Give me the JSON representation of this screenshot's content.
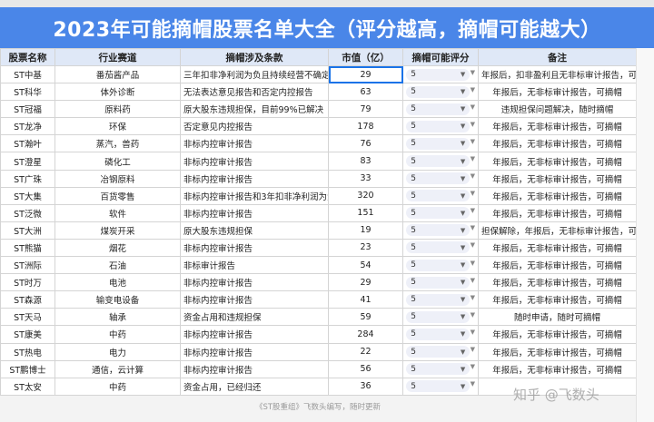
{
  "title": "2023年可能摘帽股票名单大全（评分越高，摘帽可能越大）",
  "headers": [
    "股票名称",
    "行业赛道",
    "摘帽涉及条款",
    "市值（亿）",
    "摘帽可能评分",
    "备注"
  ],
  "rows": [
    {
      "name": "ST中基",
      "industry": "番茄酱产品",
      "clause": "三年扣非净利润为负且持续经营不确定",
      "mcap": "29",
      "score": "5",
      "note": "年报后，扣非盈利且无非标审计报告，可摘帽"
    },
    {
      "name": "ST科华",
      "industry": "体外诊断",
      "clause": "无法表达意见报告和否定内控报告",
      "mcap": "63",
      "score": "5",
      "note": "年报后，无非标审计报告，可摘帽"
    },
    {
      "name": "ST冠福",
      "industry": "原料药",
      "clause": "原大股东违规担保，目前99%已解决",
      "mcap": "79",
      "score": "5",
      "note": "违规担保问题解决，随时摘帽"
    },
    {
      "name": "ST龙净",
      "industry": "环保",
      "clause": "否定意见内控报告",
      "mcap": "178",
      "score": "5",
      "note": "年报后，无非标审计报告，可摘帽"
    },
    {
      "name": "ST瀚叶",
      "industry": "蒸汽，兽药",
      "clause": "非标内控审计报告",
      "mcap": "76",
      "score": "5",
      "note": "年报后，无非标审计报告，可摘帽"
    },
    {
      "name": "ST澄星",
      "industry": "磷化工",
      "clause": "非标内控审计报告",
      "mcap": "83",
      "score": "5",
      "note": "年报后，无非标审计报告，可摘帽"
    },
    {
      "name": "ST广珠",
      "industry": "冶钢原料",
      "clause": "非标内控审计报告",
      "mcap": "33",
      "score": "5",
      "note": "年报后，无非标审计报告，可摘帽"
    },
    {
      "name": "ST大集",
      "industry": "百货零售",
      "clause": "非标内控审计报告和3年扣非净利润为负",
      "mcap": "320",
      "score": "5",
      "note": "年报后，无非标审计报告，可摘帽"
    },
    {
      "name": "ST泛微",
      "industry": "软件",
      "clause": "非标内控审计报告",
      "mcap": "151",
      "score": "5",
      "note": "年报后，无非标审计报告，可摘帽"
    },
    {
      "name": "ST大洲",
      "industry": "煤炭开采",
      "clause": "原大股东违规担保",
      "mcap": "19",
      "score": "5",
      "note": "担保解除，年报后，无非标审计报告，可摘帽"
    },
    {
      "name": "ST熊猫",
      "industry": "烟花",
      "clause": "非标内控审计报告",
      "mcap": "23",
      "score": "5",
      "note": "年报后，无非标审计报告，可摘帽"
    },
    {
      "name": "ST洲际",
      "industry": "石油",
      "clause": "非标审计报告",
      "mcap": "54",
      "score": "5",
      "note": "年报后，无非标审计报告，可摘帽"
    },
    {
      "name": "ST时万",
      "industry": "电池",
      "clause": "非标内控审计报告",
      "mcap": "29",
      "score": "5",
      "note": "年报后，无非标审计报告，可摘帽"
    },
    {
      "name": "ST森源",
      "industry": "输变电设备",
      "clause": "非标内控审计报告",
      "mcap": "41",
      "score": "5",
      "note": "年报后，无非标审计报告，可摘帽"
    },
    {
      "name": "ST天马",
      "industry": "轴承",
      "clause": "资金占用和违规担保",
      "mcap": "59",
      "score": "5",
      "note": "随时申请，随时可摘帽"
    },
    {
      "name": "ST康美",
      "industry": "中药",
      "clause": "非标内控审计报告",
      "mcap": "284",
      "score": "5",
      "note": "年报后，无非标审计报告，可摘帽"
    },
    {
      "name": "ST热电",
      "industry": "电力",
      "clause": "非标内控审计报告",
      "mcap": "22",
      "score": "5",
      "note": "年报后，无非标审计报告，可摘帽"
    },
    {
      "name": "ST鹏博士",
      "industry": "通信，云计算",
      "clause": "非标内控审计报告",
      "mcap": "56",
      "score": "5",
      "note": "年报后，无非标审计报告，可摘帽"
    },
    {
      "name": "ST太安",
      "industry": "中药",
      "clause": "资金占用，已经归还",
      "mcap": "36",
      "score": "5",
      "note": ""
    }
  ],
  "footer": "《ST股重组》飞数头编写，随时更新",
  "watermark": "知乎 @飞数头",
  "colors": {
    "title_bg": "#4a86e8",
    "header_bg": "#dfe8f7",
    "chip_bg": "#eef0f8",
    "selection": "#1a73e8"
  },
  "icons": {
    "dropdown": "triangle-down-icon"
  }
}
